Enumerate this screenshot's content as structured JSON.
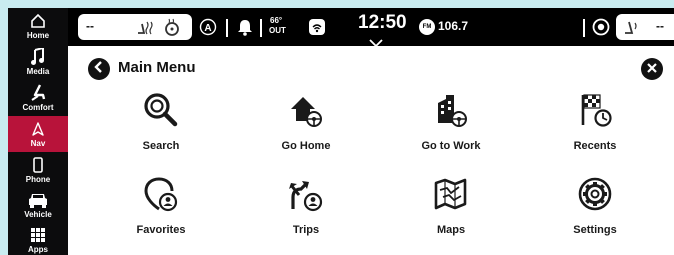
{
  "sidebar": {
    "items": [
      {
        "label": "Home",
        "icon": "home-icon"
      },
      {
        "label": "Media",
        "icon": "music-note-icon"
      },
      {
        "label": "Comfort",
        "icon": "seat-icon"
      },
      {
        "label": "Nav",
        "icon": "navigation-arrow-icon",
        "active": true
      },
      {
        "label": "Phone",
        "icon": "phone-icon"
      },
      {
        "label": "Vehicle",
        "icon": "car-icon"
      },
      {
        "label": "Apps",
        "icon": "apps-grid-icon"
      }
    ],
    "active_color": "#b8133a"
  },
  "topbar": {
    "left_temp": "--",
    "outside_temp": "66°",
    "outside_label": "OUT",
    "time": "12:50",
    "radio_band": "FM",
    "radio_freq": "106.7",
    "right_temp": "--"
  },
  "main": {
    "title": "Main Menu",
    "tiles": [
      {
        "label": "Search",
        "icon": "search-icon"
      },
      {
        "label": "Go Home",
        "icon": "go-home-icon"
      },
      {
        "label": "Go to Work",
        "icon": "go-to-work-icon"
      },
      {
        "label": "Recents",
        "icon": "recents-icon"
      },
      {
        "label": "Favorites",
        "icon": "favorites-icon"
      },
      {
        "label": "Trips",
        "icon": "trips-icon"
      },
      {
        "label": "Maps",
        "icon": "maps-icon"
      },
      {
        "label": "Settings",
        "icon": "settings-icon"
      }
    ]
  }
}
